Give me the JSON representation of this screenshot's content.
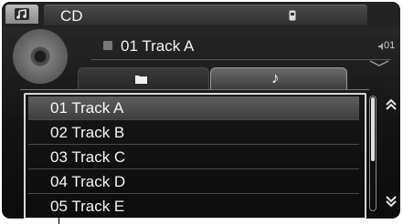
{
  "header": {
    "source_label": "CD",
    "music_tab_icon": "music-note-icon",
    "source_icon": "usb-icon"
  },
  "now_playing": {
    "title": "01 Track A",
    "volume_text": "01",
    "artwork_icon": "disc-icon"
  },
  "sub_tabs": {
    "folder_icon": "folder-icon",
    "music_glyph": "♪",
    "active": "music"
  },
  "track_list": {
    "items": [
      {
        "label": "01 Track A",
        "selected": true
      },
      {
        "label": "02 Track B",
        "selected": false
      },
      {
        "label": "03 Track C",
        "selected": false
      },
      {
        "label": "04 Track D",
        "selected": false
      },
      {
        "label": "05 Track E",
        "selected": false
      }
    ]
  },
  "scroll": {
    "up_icon": "double-chevron-up-icon",
    "down_icon": "double-chevron-down-icon"
  },
  "colors": {
    "background": "#141414",
    "text": "#f5f5f5",
    "selection": "#5e5e5e",
    "frame": "#d8d8d8"
  }
}
